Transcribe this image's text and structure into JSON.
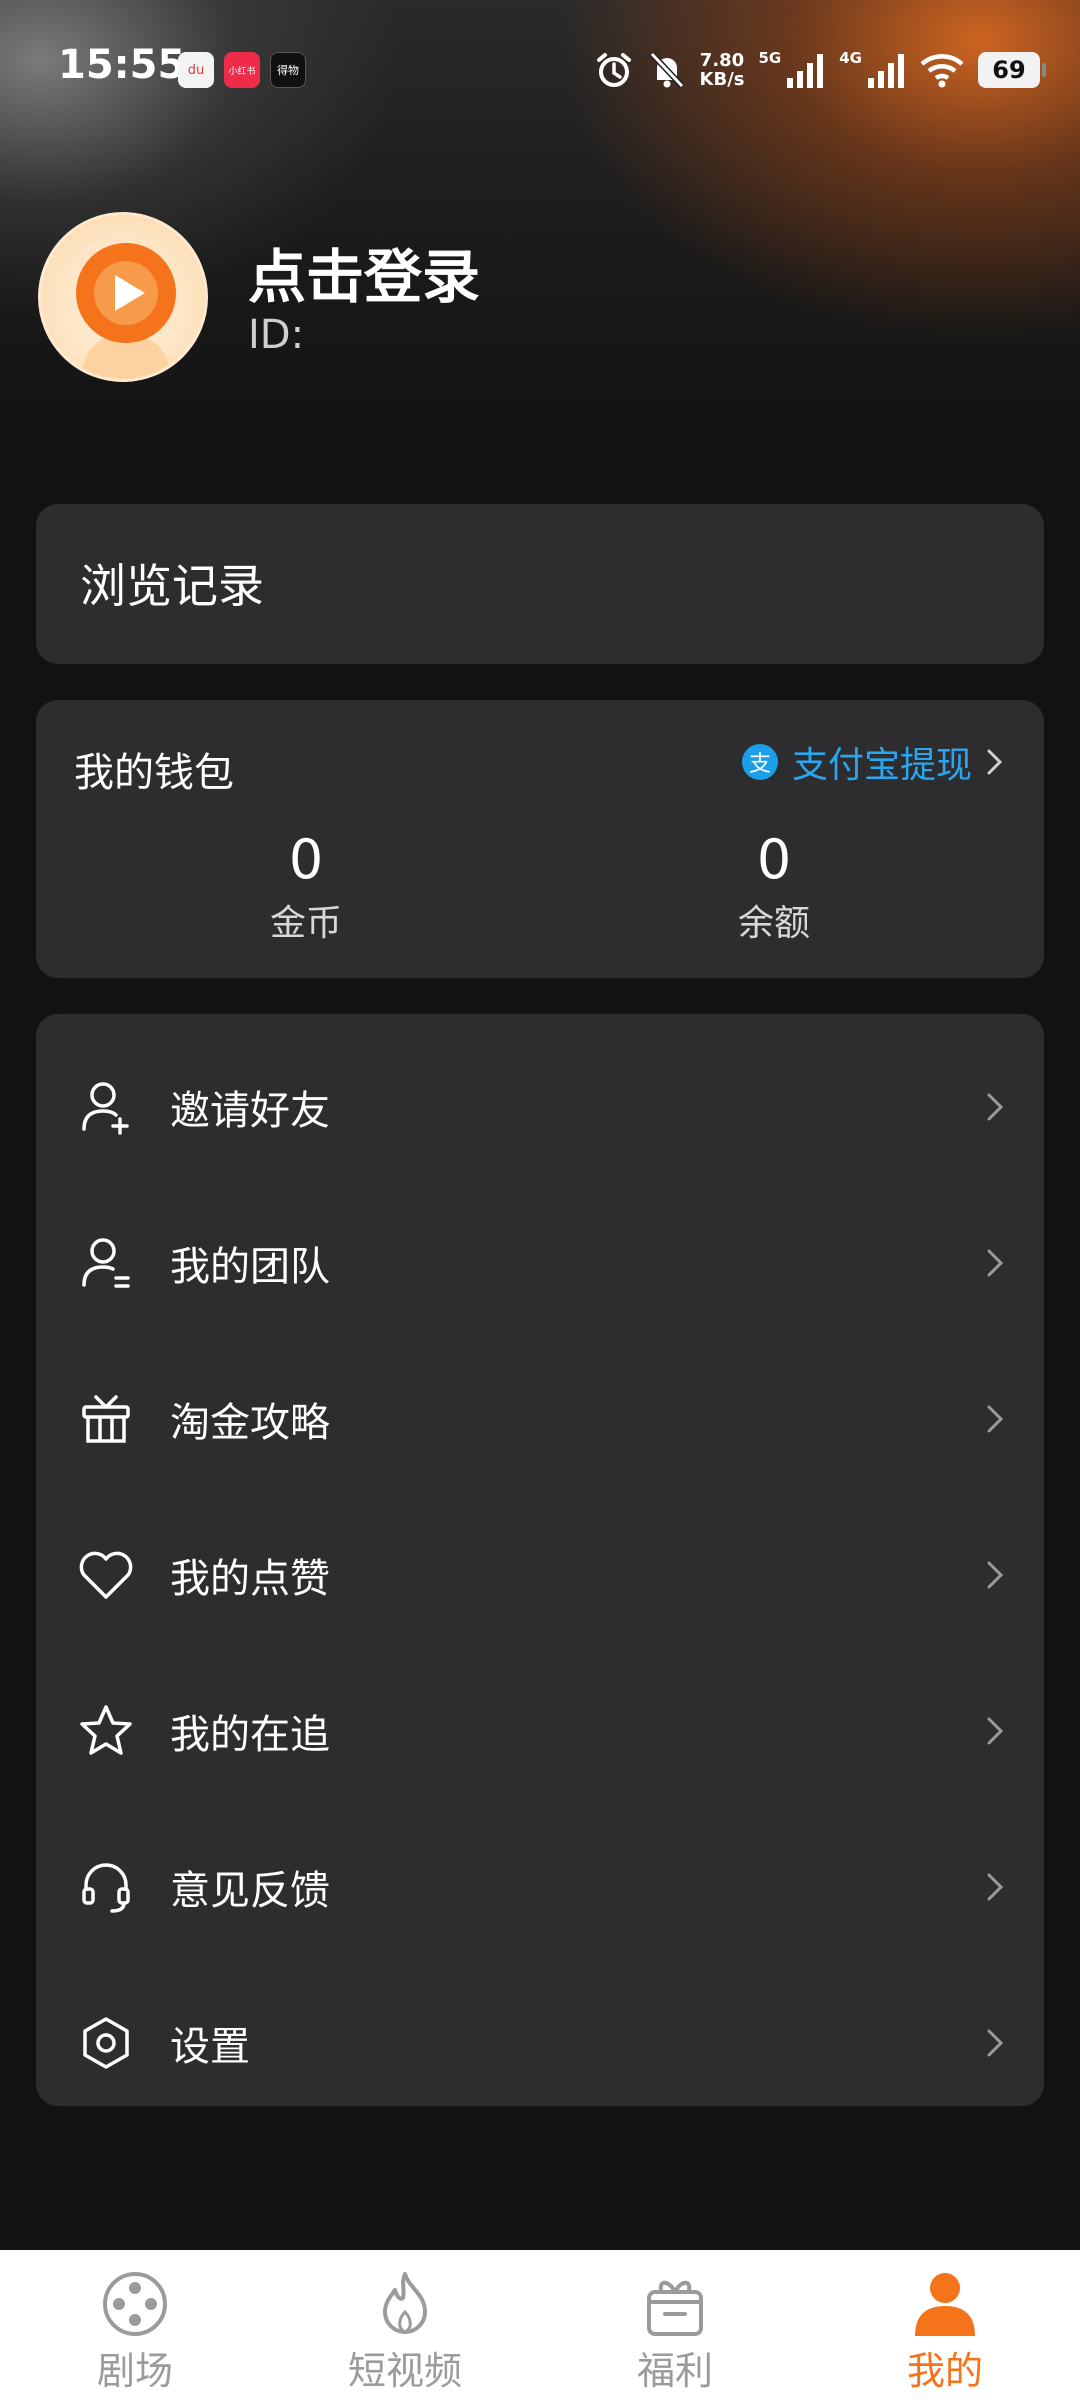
{
  "status_bar": {
    "time": "15:55",
    "app_badges": [
      "du",
      "小红书",
      "得物"
    ],
    "net_speed_value": "7.80",
    "net_speed_unit": "KB/s",
    "sig1": "5G",
    "sig2": "4G",
    "battery": "69"
  },
  "profile": {
    "login_text": "点击登录",
    "id_label": "ID:"
  },
  "history": {
    "label": "浏览记录"
  },
  "wallet": {
    "title": "我的钱包",
    "alipay_icon_text": "支",
    "alipay_label": "支付宝提现",
    "coins_value": "0",
    "coins_label": "金币",
    "balance_value": "0",
    "balance_label": "余额"
  },
  "menu": {
    "items": [
      {
        "label": "邀请好友",
        "icon": "invite-user-icon"
      },
      {
        "label": "我的团队",
        "icon": "team-icon"
      },
      {
        "label": "淘金攻略",
        "icon": "gift-icon"
      },
      {
        "label": "我的点赞",
        "icon": "heart-icon"
      },
      {
        "label": "我的在追",
        "icon": "star-icon"
      },
      {
        "label": "意见反馈",
        "icon": "headset-icon"
      },
      {
        "label": "设置",
        "icon": "settings-icon"
      }
    ]
  },
  "bottom_nav": {
    "tabs": [
      {
        "label": "剧场",
        "icon": "film-reel-icon"
      },
      {
        "label": "短视频",
        "icon": "flame-icon"
      },
      {
        "label": "福利",
        "icon": "gift-box-icon"
      },
      {
        "label": "我的",
        "icon": "user-icon",
        "active": true
      }
    ]
  },
  "colors": {
    "accent": "#F5731B",
    "link": "#2AA6F0",
    "card_bg": "#2D2C2E",
    "page_bg": "#121212"
  }
}
